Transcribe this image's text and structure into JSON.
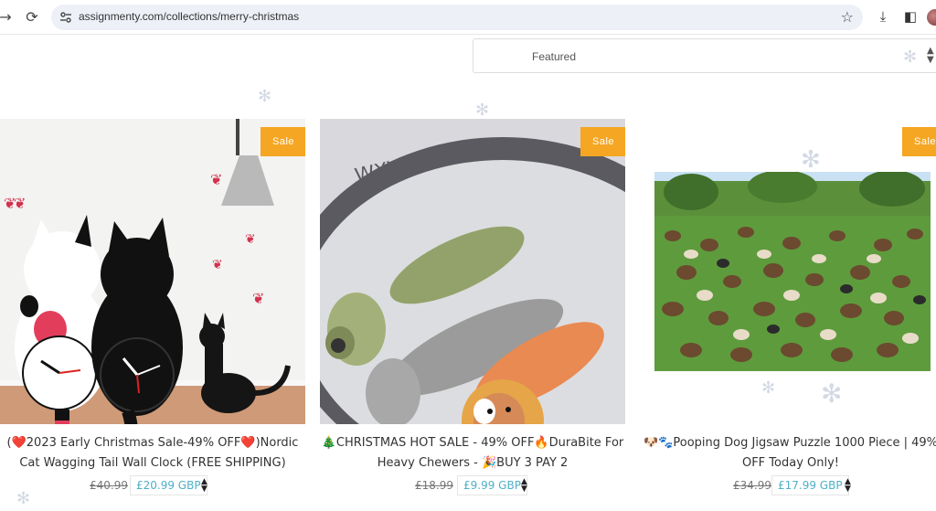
{
  "browser": {
    "url": "assignmenty.com/collections/merry-christmas",
    "back_icon": "arrow-right-icon",
    "reload_icon": "reload-icon"
  },
  "sort": {
    "selected": "Featured"
  },
  "products": [
    {
      "badge": "Sale",
      "title_line1": "(❤️2023 Early Christmas Sale-49% OFF❤️)Nordic",
      "title_line2": "Cat Wagging Tail Wall Clock (FREE SHIPPING)",
      "old_price": "£40.99",
      "new_price": "£20.99 GBP"
    },
    {
      "badge": "Sale",
      "title_line1": "🎄CHRISTMAS HOT SALE - 49% OFF🔥DuraBite For",
      "title_line2": "Heavy Chewers - 🎉BUY 3 PAY 2",
      "old_price": "£18.99",
      "new_price": "£9.99 GBP"
    },
    {
      "badge": "Sale",
      "title_line1": "🐶🐾Pooping Dog Jigsaw Puzzle 1000 Piece | 49%",
      "title_line2": "OFF Today Only!",
      "old_price": "£34.99",
      "new_price": "£17.99 GBP"
    }
  ]
}
